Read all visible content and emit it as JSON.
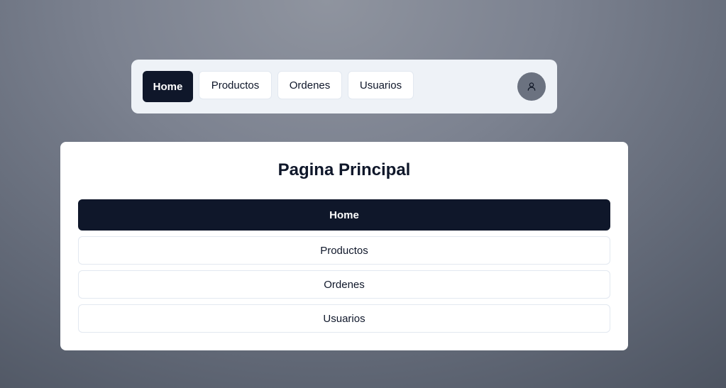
{
  "navbar": {
    "items": [
      {
        "label": "Home",
        "active": true
      },
      {
        "label": "Productos",
        "active": false
      },
      {
        "label": "Ordenes",
        "active": false
      },
      {
        "label": "Usuarios",
        "active": false
      }
    ],
    "avatar_icon": "user-icon"
  },
  "main": {
    "title": "Pagina Principal",
    "items": [
      {
        "label": "Home",
        "active": true
      },
      {
        "label": "Productos",
        "active": false
      },
      {
        "label": "Ordenes",
        "active": false
      },
      {
        "label": "Usuarios",
        "active": false
      }
    ]
  },
  "colors": {
    "primary": "#0f172a",
    "navbar_bg": "#eef2f7",
    "avatar_bg": "#6b7280",
    "border": "#e2e8f0"
  }
}
